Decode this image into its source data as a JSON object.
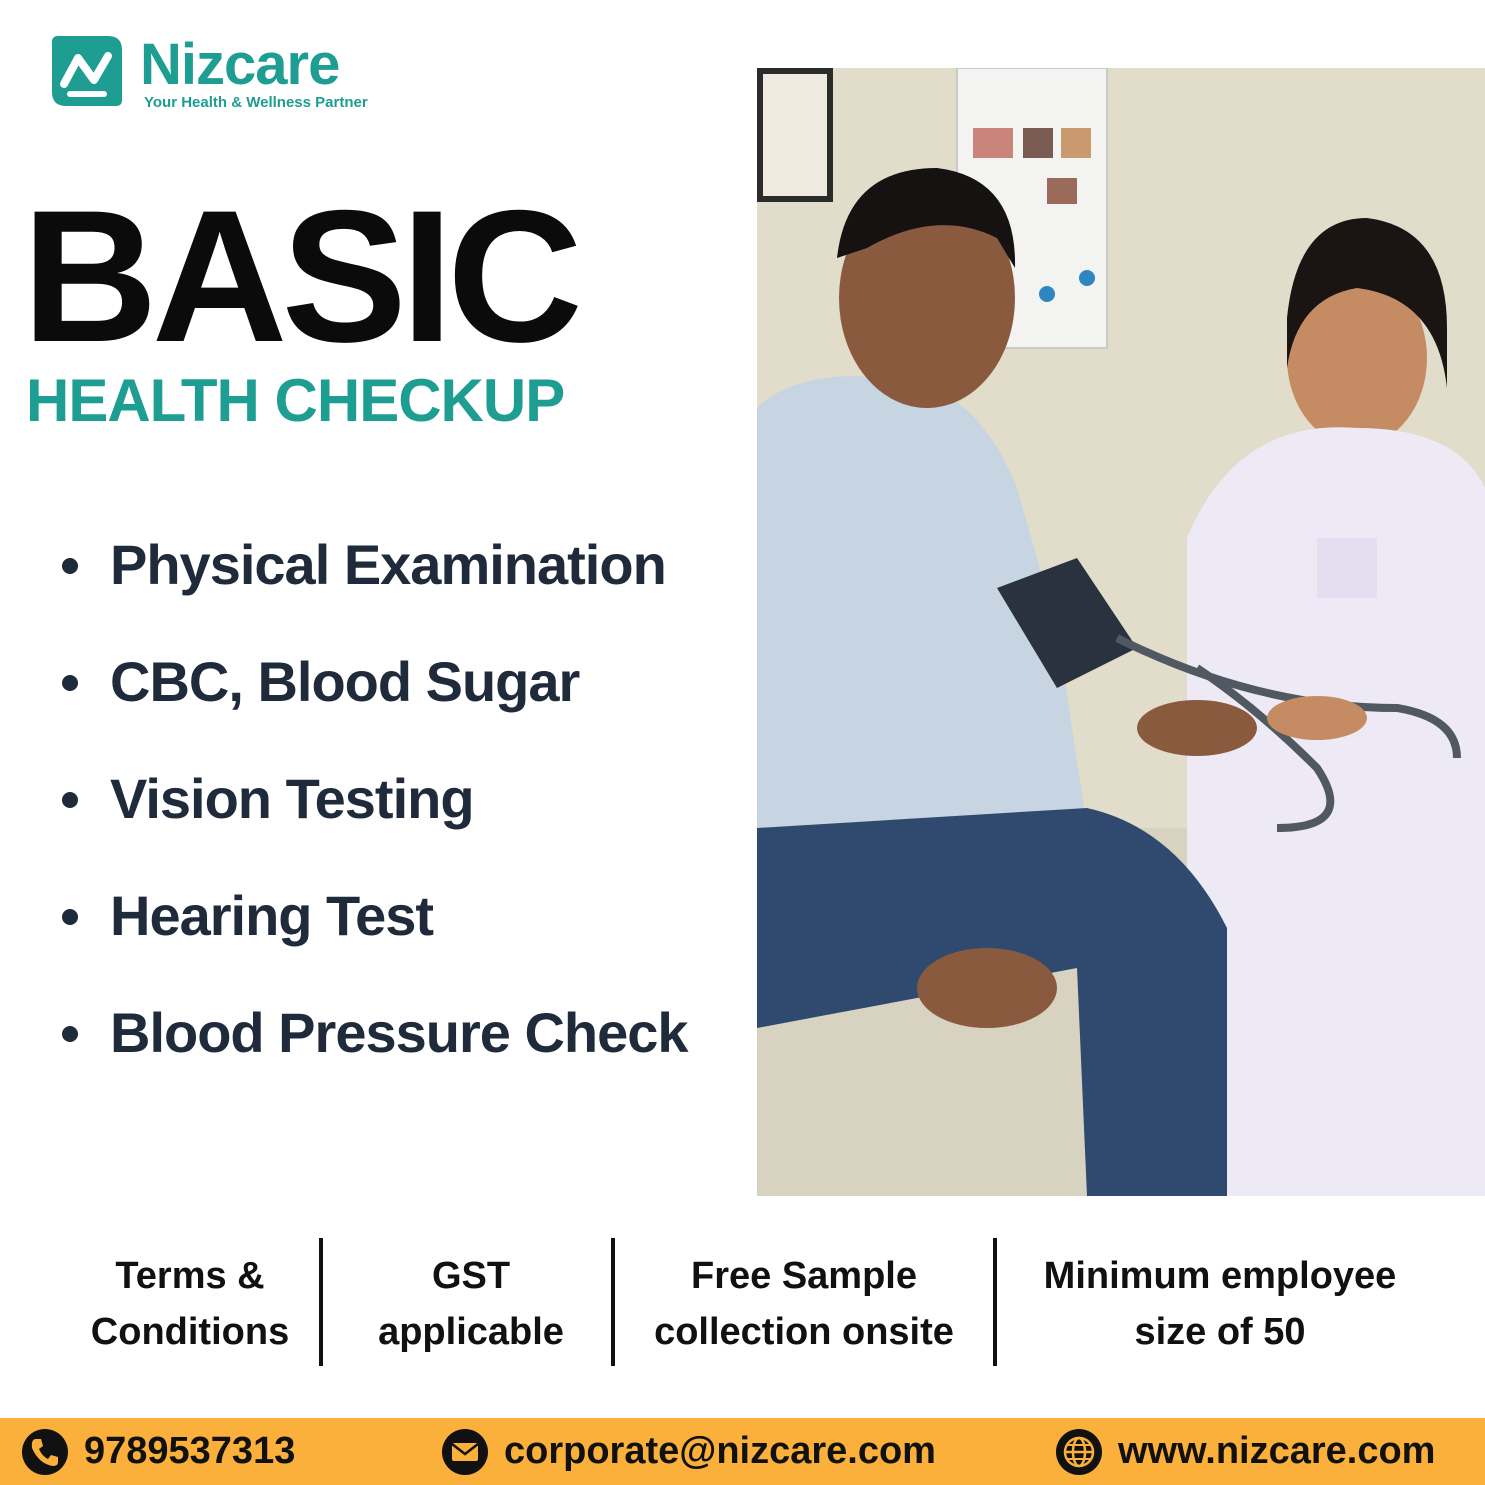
{
  "brand": {
    "name": "Nizcare",
    "tagline": "Your Health & Wellness Partner",
    "color": "#1e9e92"
  },
  "headline": "BASIC",
  "subheadline": "HEALTH CHECKUP",
  "features": [
    "Physical Examination",
    "CBC, Blood Sugar",
    "Vision Testing",
    "Hearing Test",
    "Blood Pressure Check"
  ],
  "terms": [
    {
      "line1": "Terms &",
      "line2": "Conditions"
    },
    {
      "line1": "GST",
      "line2": "applicable"
    },
    {
      "line1": "Free Sample",
      "line2": "collection onsite"
    },
    {
      "line1": "Minimum employee",
      "line2": "size of 50"
    }
  ],
  "contact": {
    "phone": "9789537313",
    "email": "corporate@nizcare.com",
    "website": "www.nizcare.com",
    "bar_color": "#fbb03b",
    "icons": [
      "phone-icon",
      "mail-icon",
      "globe-icon"
    ]
  }
}
